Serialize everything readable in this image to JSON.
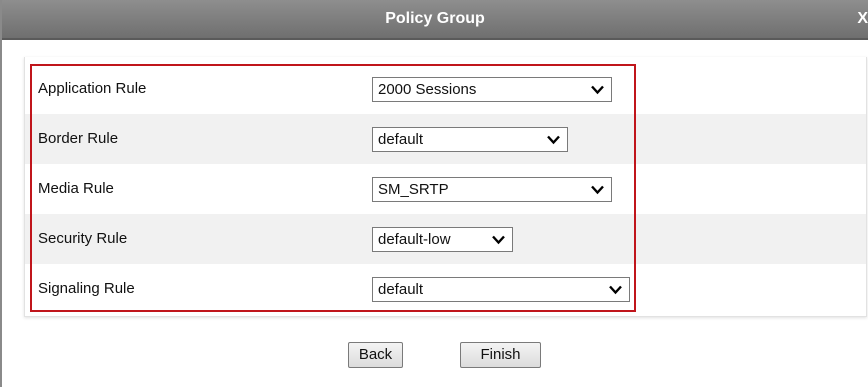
{
  "dialog": {
    "title": "Policy Group",
    "close_label": "X"
  },
  "rules": [
    {
      "label": "Application Rule",
      "value": "2000 Sessions"
    },
    {
      "label": "Border Rule",
      "value": "default"
    },
    {
      "label": "Media Rule",
      "value": "SM_SRTP"
    },
    {
      "label": "Security Rule",
      "value": "default-low"
    },
    {
      "label": "Signaling Rule",
      "value": "default"
    }
  ],
  "buttons": {
    "back_label": "Back",
    "finish_label": "Finish"
  },
  "colors": {
    "highlight_border": "#c0151b",
    "titlebar": "#7f7f7f",
    "row_shade": "#f1f1f1"
  }
}
